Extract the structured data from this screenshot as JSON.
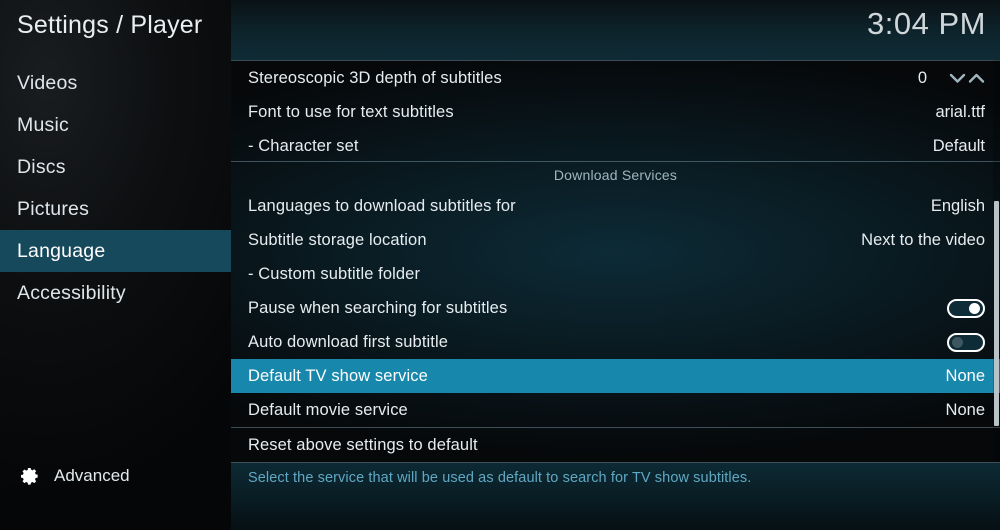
{
  "header": {
    "title": "Settings / Player",
    "clock": "3:04 PM"
  },
  "sidebar": {
    "items": [
      {
        "label": "Videos",
        "selected": false
      },
      {
        "label": "Music",
        "selected": false
      },
      {
        "label": "Discs",
        "selected": false
      },
      {
        "label": "Pictures",
        "selected": false
      },
      {
        "label": "Language",
        "selected": true
      },
      {
        "label": "Accessibility",
        "selected": false
      }
    ],
    "advanced": {
      "label": "Advanced",
      "icon": "gear-icon"
    }
  },
  "main": {
    "rows": [
      {
        "label": "Stereoscopic 3D depth of subtitles",
        "value": "0",
        "control": "spinner",
        "selected": false
      },
      {
        "label": "Font to use for text subtitles",
        "value": "arial.ttf",
        "control": "text",
        "selected": false
      },
      {
        "label": "- Character set",
        "value": "Default",
        "control": "text",
        "selected": false
      }
    ],
    "group_header": "Download Services",
    "rows2": [
      {
        "label": "Languages to download subtitles for",
        "value": "English",
        "control": "text",
        "selected": false
      },
      {
        "label": "Subtitle storage location",
        "value": "Next to the video",
        "control": "text",
        "selected": false
      },
      {
        "label": "- Custom subtitle folder",
        "value": "",
        "control": "text",
        "selected": false
      },
      {
        "label": "Pause when searching for subtitles",
        "value": "",
        "control": "toggle",
        "toggle_state": "on",
        "selected": false
      },
      {
        "label": "Auto download first subtitle",
        "value": "",
        "control": "toggle",
        "toggle_state": "off",
        "selected": false
      },
      {
        "label": "Default TV show service",
        "value": "None",
        "control": "text",
        "selected": true
      },
      {
        "label": "Default movie service",
        "value": "None",
        "control": "text",
        "selected": false
      }
    ],
    "reset_row": {
      "label": "Reset above settings to default",
      "value": "",
      "control": "none",
      "selected": false
    },
    "scrollbar": {
      "thumb_top_pct": 35,
      "thumb_height_pct": 56
    }
  },
  "help": {
    "text": "Select the service that will be used as default to search for TV show subtitles."
  },
  "colors": {
    "selection": "#1787ab",
    "sidebar_selection": "#17495c",
    "help_text": "#5fa8c4",
    "group_header": "#9fb6bf"
  }
}
